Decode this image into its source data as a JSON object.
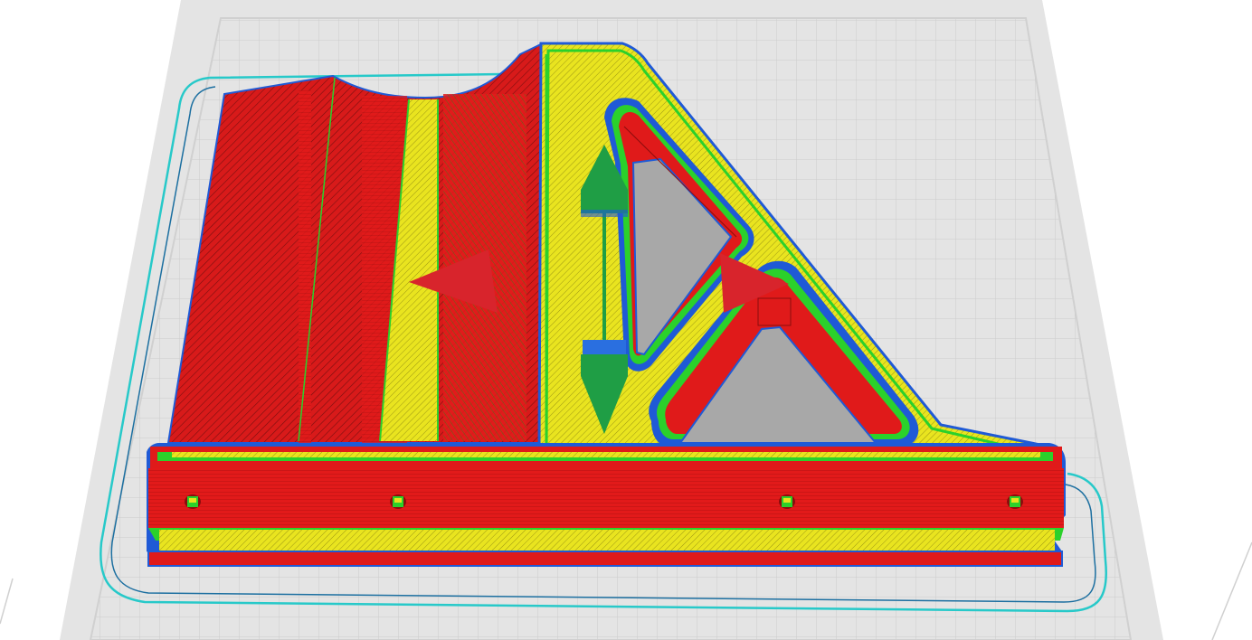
{
  "app": {
    "view": "layer-preview",
    "colors": {
      "background": "#ffffff",
      "bed": "#e6e6e6",
      "bed_grid": "#c8c8c8",
      "wall_outer": "#e01a1a",
      "wall_inner": "#2bd12b",
      "infill": "#e6e21e",
      "skirt": "#27c9c9",
      "outline": "#1f5ad6",
      "hole": "#a8a8a8",
      "gizmo_move": "#1f9e45",
      "gizmo_rotate": "#d8242c",
      "gizmo_handle": "#2a6fe0"
    }
  },
  "model": {
    "shape": "L-bracket with triangular gusset",
    "mounting_holes": 4
  },
  "gizmo": {
    "move_arrows": [
      "up-arrow",
      "down-arrow"
    ],
    "rotate_handles": [
      "left-arrow",
      "right-arrow"
    ]
  }
}
